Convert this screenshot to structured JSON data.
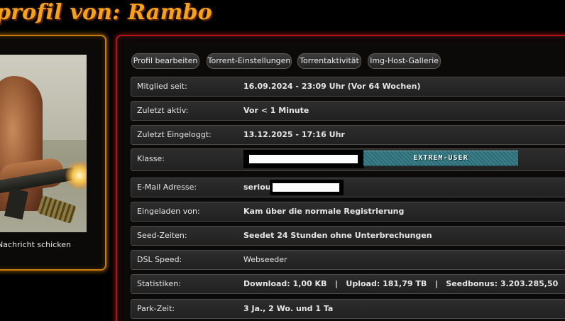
{
  "header": {
    "title": "profil von: Rambo"
  },
  "sidebar": {
    "send_message": "Nachricht schicken"
  },
  "tabs": [
    {
      "label": "Profil bearbeiten"
    },
    {
      "label": "Torrent-Einstellungen"
    },
    {
      "label": "Torrentaktivität"
    },
    {
      "label": "Img-Host-Gallerie"
    }
  ],
  "rows": {
    "member_since": {
      "label": "Mitglied seit:",
      "value": "16.09.2024 - 23:09 Uhr (Vor 64 Wochen)"
    },
    "last_active": {
      "label": "Zuletzt aktiv:",
      "value": "Vor < 1 Minute"
    },
    "last_login": {
      "label": "Zuletzt Eingeloggt:",
      "value": "13.12.2025 - 17:16 Uhr"
    },
    "class": {
      "label": "Klasse:",
      "banner": "EXTREM-USER"
    },
    "email": {
      "label": "E-Mail Adresse:",
      "value": "serious"
    },
    "invited_by": {
      "label": "Eingeladen von:",
      "value": "Kam über die normale Registrierung"
    },
    "seed_times": {
      "label": "Seed-Zeiten:",
      "value": "Seedet 24 Stunden ohne Unterbrechungen"
    },
    "dsl_speed": {
      "label": "DSL Speed:",
      "value": "Webseeder"
    },
    "stats": {
      "label": "Statistiken:",
      "value": "Download: 1,00 KB   |   Upload: 181,79 TB   |   Seedbonus: 3.203.285,50"
    },
    "park_time": {
      "label": "Park-Zeit:",
      "value": "3 Ja., 2 Wo. und 1 Ta"
    }
  },
  "colors": {
    "title": "#f7a21b",
    "left_border": "#c77b0c",
    "right_border": "#b51414",
    "banner": "#3b808a"
  }
}
